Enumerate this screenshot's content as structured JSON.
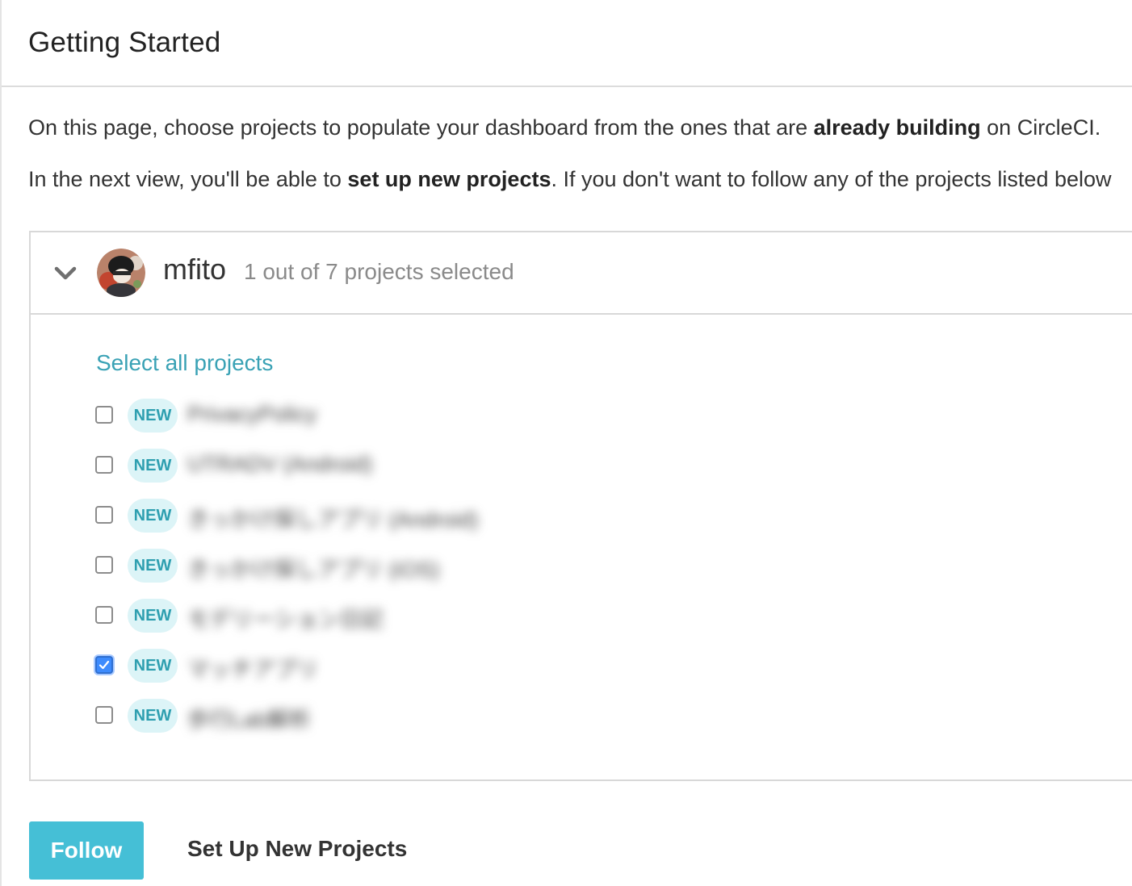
{
  "header": {
    "title": "Getting Started"
  },
  "intro": {
    "line1": {
      "before": "On this page, choose projects to populate your dashboard from the ones that are ",
      "bold": "already building",
      "after": " on CircleCI."
    },
    "line2": {
      "before": "In the next view, you'll be able to ",
      "bold": "set up new projects",
      "after": ". If you don't want to follow any of the projects listed below"
    }
  },
  "org": {
    "name": "mfito",
    "count_text": "1 out of 7 projects selected",
    "select_all": "Select all projects",
    "projects": [
      {
        "badge": "NEW",
        "name": "PrivacyPolicy",
        "checked": false
      },
      {
        "badge": "NEW",
        "name": "UTRADV (Android)",
        "checked": false
      },
      {
        "badge": "NEW",
        "name": "きっかけ探しアプリ (Android)",
        "checked": false
      },
      {
        "badge": "NEW",
        "name": "きっかけ探しアプリ (iOS)",
        "checked": false
      },
      {
        "badge": "NEW",
        "name": "モデリーション日記",
        "checked": false
      },
      {
        "badge": "NEW",
        "name": "マッチアプリ",
        "checked": true
      },
      {
        "badge": "NEW",
        "name": "歩行Lab解析",
        "checked": false
      }
    ]
  },
  "actions": {
    "follow": "Follow",
    "setup": "Set Up New Projects"
  },
  "colors": {
    "accent": "#45bfd6",
    "link": "#3aa2b5",
    "badge_bg": "#dcf4f7",
    "checkbox_checked": "#3d8bfd"
  }
}
